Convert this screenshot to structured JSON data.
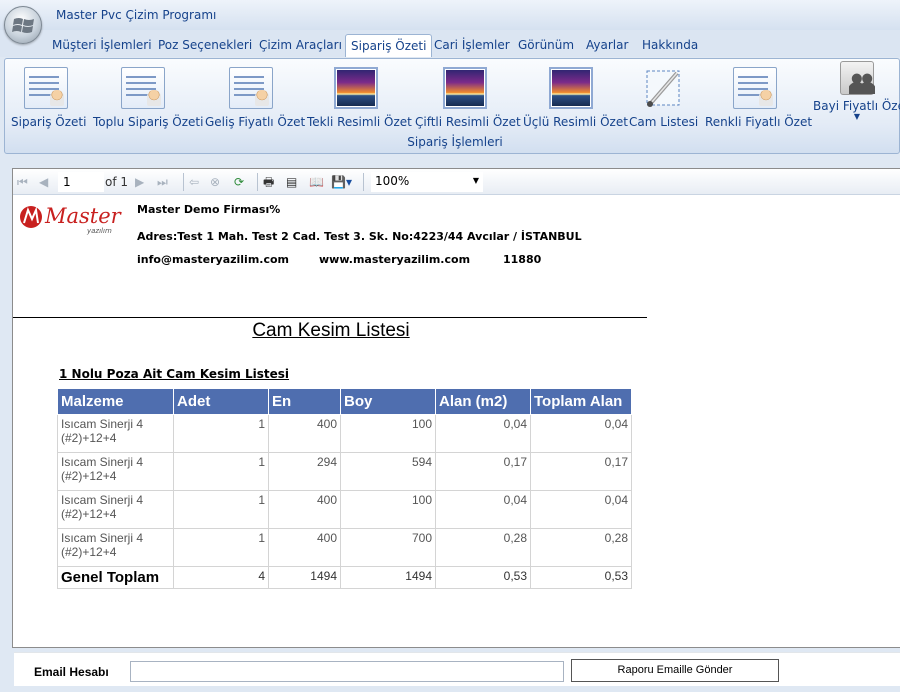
{
  "window": {
    "title": "Master Pvc Çizim Programı"
  },
  "menu_tabs": [
    {
      "label": "Müşteri İşlemleri"
    },
    {
      "label": "Poz Seçenekleri"
    },
    {
      "label": "Çizim Araçları"
    },
    {
      "label": "Sipariş Özeti"
    },
    {
      "label": "Cari İşlemler"
    },
    {
      "label": "Görünüm"
    },
    {
      "label": "Ayarlar"
    },
    {
      "label": "Hakkında"
    }
  ],
  "ribbon": {
    "group_label": "Sipariş İşlemleri",
    "buttons": [
      {
        "label": "Sipariş Özeti",
        "icon": "list-user-icon"
      },
      {
        "label": "Toplu Sipariş Özeti",
        "icon": "list-user-icon"
      },
      {
        "label": "Geliş Fiyatlı Özet",
        "icon": "list-user-icon"
      },
      {
        "label": "Tekli Resimli Özet",
        "icon": "photo-icon"
      },
      {
        "label": "Çiftli Resimli Özet",
        "icon": "photo-icon"
      },
      {
        "label": "Üçlü Resimli Özet",
        "icon": "photo-icon"
      },
      {
        "label": "Cam Listesi",
        "icon": "glass-icon"
      },
      {
        "label": "Renkli Fiyatlı Özet",
        "icon": "list-user-icon"
      },
      {
        "label": "Bayi Fiyatlı Özet",
        "icon": "users-icon"
      }
    ]
  },
  "report_toolbar": {
    "page_value": "1",
    "page_of": "of 1",
    "zoom": "100%"
  },
  "company": {
    "name": "Master Demo Firması%",
    "address": "Adres:Test 1 Mah. Test 2 Cad. Test 3. Sk. No:4223/44 Avcılar / İSTANBUL",
    "email": "info@masteryazilim.com",
    "web": "www.masteryazilim.com",
    "phone": "11880",
    "logo_text": "Master",
    "logo_sub": "yazılım"
  },
  "report": {
    "title": "Cam Kesim Listesi",
    "subtitle": " 1 Nolu Poza Ait Cam Kesim Listesi",
    "columns": [
      "Malzeme",
      "Adet",
      "En",
      "Boy",
      "Alan (m2)",
      "Toplam Alan"
    ],
    "rows": [
      {
        "malzeme": "Isıcam Sinerji 4 (#2)+12+4",
        "adet": "1",
        "en": "400",
        "boy": "100",
        "alan": "0,04",
        "toplam": "0,04"
      },
      {
        "malzeme": "Isıcam Sinerji 4 (#2)+12+4",
        "adet": "1",
        "en": "294",
        "boy": "594",
        "alan": "0,17",
        "toplam": "0,17"
      },
      {
        "malzeme": "Isıcam Sinerji 4 (#2)+12+4",
        "adet": "1",
        "en": "400",
        "boy": "100",
        "alan": "0,04",
        "toplam": "0,04"
      },
      {
        "malzeme": "Isıcam Sinerji 4 (#2)+12+4",
        "adet": "1",
        "en": "400",
        "boy": "700",
        "alan": "0,28",
        "toplam": "0,28"
      }
    ],
    "total": {
      "label": "Genel Toplam",
      "adet": "4",
      "en": "1494",
      "boy": "1494",
      "alan": "0,53",
      "toplam": "0,53"
    }
  },
  "email": {
    "label": "Email Hesabı",
    "value": "",
    "send_label": "Raporu Emaille Gönder"
  }
}
